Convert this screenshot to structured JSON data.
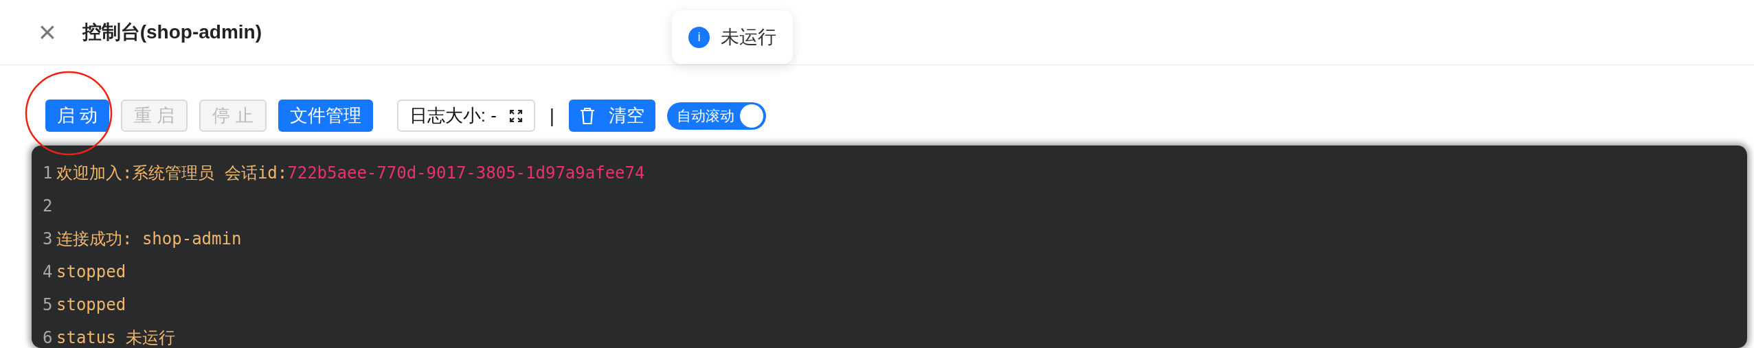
{
  "header": {
    "close": "×",
    "title": "控制台(shop-admin)"
  },
  "toast": {
    "icon": "i",
    "text": "未运行"
  },
  "toolbar": {
    "buttons": [
      {
        "kind": "primary",
        "label": "启 动",
        "disabled": false
      },
      {
        "kind": "primary",
        "label": "重 启",
        "disabled": true
      },
      {
        "kind": "primary",
        "label": "停 止",
        "disabled": true
      },
      {
        "kind": "primary",
        "label": "文件管理",
        "disabled": false
      }
    ],
    "log_size": {
      "label": "日志大小: -"
    },
    "separator": "|",
    "clear_button": {
      "label": "清空"
    },
    "auto_scroll": {
      "label": "自动滚动",
      "on": true
    }
  },
  "console": {
    "lines": [
      {
        "number": "1",
        "segments": [
          {
            "kind": "text",
            "text": "欢迎加入:系统管理员 会话id:"
          },
          {
            "kind": "id",
            "text": "722b5aee-770d-9017-3805-1d97a9afee74"
          }
        ]
      },
      {
        "number": "2"
      },
      {
        "number": "3",
        "segments": [
          {
            "kind": "text",
            "text": "连接成功: shop-admin"
          }
        ]
      },
      {
        "number": "4",
        "segments": [
          {
            "kind": "text",
            "text": "stopped"
          }
        ]
      },
      {
        "number": "5",
        "segments": [
          {
            "kind": "text",
            "text": "stopped"
          }
        ]
      },
      {
        "number": "6",
        "segments": [
          {
            "kind": "text",
            "text": "status 未运行"
          }
        ]
      }
    ]
  }
}
